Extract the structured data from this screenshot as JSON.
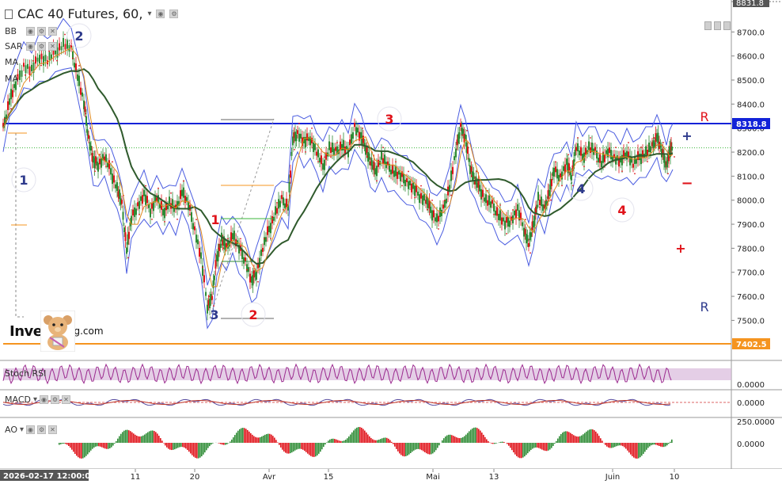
{
  "chart": {
    "title": "CAC 40 Futures, 60,",
    "indicators": [
      "BB",
      "SAR",
      "MA",
      "MA"
    ],
    "panes": {
      "stoch": "Stoch RSI",
      "macd": "MACD",
      "ao": "AO"
    },
    "logo": {
      "left": "Inve",
      "right": "g.com"
    }
  },
  "chart_data": {
    "type": "line",
    "x_ticks": [
      "2026-02-17 12:00:00",
      "11",
      "20",
      "Avr",
      "15",
      "Mai",
      "13",
      "Juin",
      "10"
    ],
    "y_ticks": [
      "8831.8",
      "8700.0",
      "8600.0",
      "8500.0",
      "8400.0",
      "8300.0",
      "8200.0",
      "8100.0",
      "8000.0",
      "7900.0",
      "7800.0",
      "7700.0",
      "7600.0",
      "7500.0"
    ],
    "ylim": [
      7400,
      8840
    ],
    "price_labels": {
      "resistance": "8318.8",
      "support": "7402.5"
    },
    "stoch_ticks": [
      "0.0000"
    ],
    "macd_ticks": [
      "0.0000"
    ],
    "ao_ticks": [
      "250.0000",
      "0.0000"
    ],
    "close_series": [
      [
        0,
        8300
      ],
      [
        8,
        8420
      ],
      [
        16,
        8480
      ],
      [
        26,
        8560
      ],
      [
        36,
        8540
      ],
      [
        46,
        8600
      ],
      [
        56,
        8580
      ],
      [
        66,
        8620
      ],
      [
        76,
        8650
      ],
      [
        86,
        8630
      ],
      [
        94,
        8520
      ],
      [
        102,
        8400
      ],
      [
        108,
        8260
      ],
      [
        114,
        8160
      ],
      [
        120,
        8150
      ],
      [
        128,
        8180
      ],
      [
        136,
        8120
      ],
      [
        144,
        8050
      ],
      [
        150,
        7980
      ],
      [
        156,
        7800
      ],
      [
        162,
        7920
      ],
      [
        170,
        7980
      ],
      [
        178,
        8020
      ],
      [
        186,
        7960
      ],
      [
        194,
        8010
      ],
      [
        202,
        7950
      ],
      [
        210,
        7990
      ],
      [
        218,
        7960
      ],
      [
        226,
        8040
      ],
      [
        234,
        7980
      ],
      [
        242,
        7880
      ],
      [
        250,
        7760
      ],
      [
        258,
        7560
      ],
      [
        264,
        7600
      ],
      [
        270,
        7760
      ],
      [
        276,
        7840
      ],
      [
        282,
        7800
      ],
      [
        290,
        7860
      ],
      [
        298,
        7800
      ],
      [
        306,
        7750
      ],
      [
        314,
        7660
      ],
      [
        320,
        7700
      ],
      [
        328,
        7800
      ],
      [
        336,
        7880
      ],
      [
        344,
        7950
      ],
      [
        352,
        8000
      ],
      [
        360,
        7980
      ],
      [
        366,
        8250
      ],
      [
        372,
        8280
      ],
      [
        380,
        8240
      ],
      [
        388,
        8260
      ],
      [
        396,
        8200
      ],
      [
        404,
        8140
      ],
      [
        412,
        8220
      ],
      [
        420,
        8200
      ],
      [
        428,
        8230
      ],
      [
        436,
        8200
      ],
      [
        444,
        8310
      ],
      [
        452,
        8260
      ],
      [
        458,
        8220
      ],
      [
        464,
        8160
      ],
      [
        470,
        8120
      ],
      [
        478,
        8180
      ],
      [
        486,
        8140
      ],
      [
        494,
        8120
      ],
      [
        502,
        8100
      ],
      [
        510,
        8080
      ],
      [
        518,
        8050
      ],
      [
        526,
        8020
      ],
      [
        534,
        8000
      ],
      [
        540,
        7960
      ],
      [
        548,
        7920
      ],
      [
        556,
        7960
      ],
      [
        564,
        8060
      ],
      [
        572,
        8200
      ],
      [
        578,
        8310
      ],
      [
        584,
        8250
      ],
      [
        590,
        8140
      ],
      [
        596,
        8080
      ],
      [
        602,
        8050
      ],
      [
        610,
        8000
      ],
      [
        618,
        7980
      ],
      [
        626,
        7940
      ],
      [
        634,
        7900
      ],
      [
        642,
        7920
      ],
      [
        650,
        7960
      ],
      [
        658,
        7880
      ],
      [
        664,
        7820
      ],
      [
        670,
        7900
      ],
      [
        676,
        8010
      ],
      [
        684,
        7960
      ],
      [
        690,
        8040
      ],
      [
        696,
        8120
      ],
      [
        704,
        8100
      ],
      [
        712,
        8150
      ],
      [
        718,
        8100
      ],
      [
        724,
        8220
      ],
      [
        732,
        8180
      ],
      [
        740,
        8220
      ],
      [
        748,
        8200
      ],
      [
        756,
        8160
      ],
      [
        764,
        8200
      ],
      [
        772,
        8180
      ],
      [
        780,
        8160
      ],
      [
        788,
        8200
      ],
      [
        796,
        8150
      ],
      [
        804,
        8180
      ],
      [
        812,
        8200
      ],
      [
        820,
        8220
      ],
      [
        826,
        8270
      ],
      [
        832,
        8200
      ],
      [
        838,
        8150
      ],
      [
        842,
        8200
      ],
      [
        846,
        8220
      ]
    ],
    "annotations": {
      "wave_blue": [
        {
          "label": "1",
          "color": "#2e3a8c"
        },
        {
          "label": "2",
          "color": "#2e3a8c"
        },
        {
          "label": "3",
          "color": "#2e3a8c"
        },
        {
          "label": "4",
          "color": "#2e3a8c"
        },
        {
          "label": "R",
          "color": "#2e3a8c"
        },
        {
          "label": "+",
          "color": "#2e3a8c"
        }
      ],
      "wave_red": [
        {
          "label": "1",
          "color": "#e0131a"
        },
        {
          "label": "2",
          "color": "#e0131a"
        },
        {
          "label": "3",
          "color": "#e0131a"
        },
        {
          "label": "4",
          "color": "#e0131a"
        },
        {
          "label": "R",
          "color": "#e0131a"
        },
        {
          "label": "−",
          "color": "#e0131a"
        },
        {
          "label": "+",
          "color": "#e0131a"
        }
      ]
    },
    "colors": {
      "resistance_line": "#1222d8",
      "support_line": "#f5941f",
      "ma_long": "#2f5a2c",
      "bollinger": "#4a5ce0",
      "up_candle": "#2e8b35",
      "down_candle": "#e0131a",
      "sar": "#e0131a",
      "stoch_band": "#d9b9dc",
      "stoch_line": "#9b2a8f",
      "macd_line": "#5a4ea0",
      "signal_line": "#c0392b"
    }
  }
}
